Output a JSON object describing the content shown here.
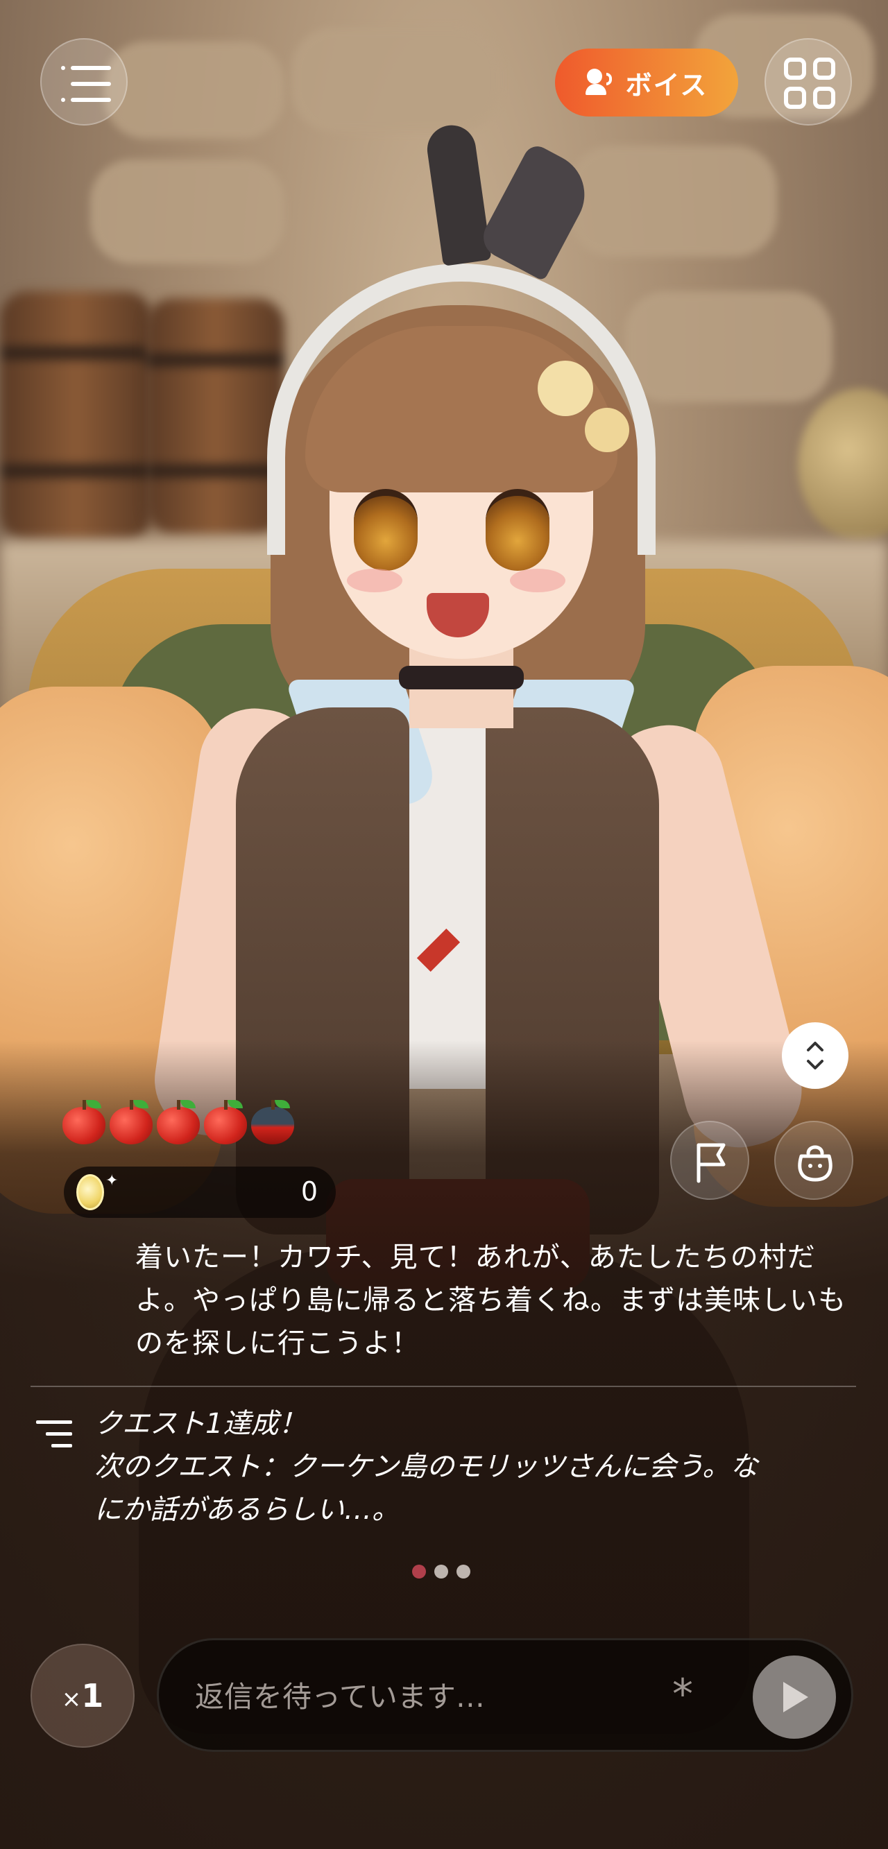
{
  "header": {
    "voice_label": "ボイス"
  },
  "stats": {
    "apples_total": 5,
    "apples_full": 4,
    "coins": "0"
  },
  "dialogue": {
    "text": "着いたー！カワチ、見て！あれが、あたしたちの村だよ。やっぱり島に帰ると落ち着くね。まずは美味しいものを探しに行こうよ！"
  },
  "quest": {
    "lines": [
      "クエスト1達成！",
      "次のクエスト：クーケン島のモリッツさんに会う。な",
      "にか話があるらしい…。"
    ]
  },
  "pager": {
    "count": 3,
    "active": 0
  },
  "input": {
    "speed_x": "×",
    "speed_n": "1",
    "placeholder": "返信を待っています…",
    "asterisk": "*"
  },
  "icons": {
    "menu": "menu-icon",
    "voice": "voice-icon",
    "grid": "grid-icon",
    "expand": "chevron-updown-icon",
    "flag": "flag-icon",
    "bag": "bag-icon",
    "quest": "list-icon",
    "send": "play-icon"
  },
  "colors": {
    "voice_gradient_start": "#ef5a2c",
    "voice_gradient_end": "#f2a43b",
    "apple_red": "#d1241c",
    "active_dot": "#d44a5a"
  }
}
